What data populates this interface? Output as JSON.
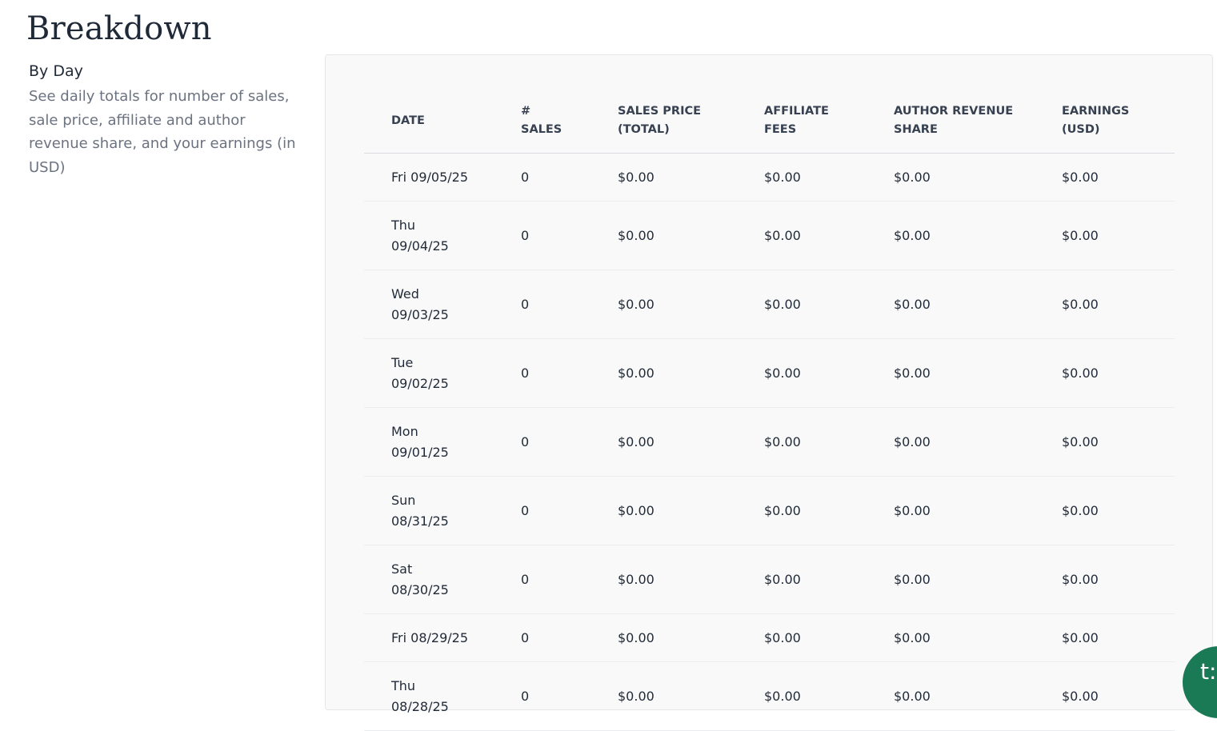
{
  "page": {
    "title": "Breakdown"
  },
  "section": {
    "title": "By Day",
    "description": "See daily totals for number of sales, sale price, affiliate and author revenue share, and your earnings (in USD)"
  },
  "table": {
    "headers": {
      "date": "DATE",
      "sales_line1": "#",
      "sales_line2": "SALES",
      "price_line1": "SALES PRICE",
      "price_line2": "(TOTAL)",
      "affiliate_line1": "AFFILIATE",
      "affiliate_line2": "FEES",
      "author_line1": "AUTHOR REVENUE",
      "author_line2": "SHARE",
      "earnings_line1": "EARNINGS",
      "earnings_line2": "(USD)"
    },
    "rows": [
      {
        "day": "Fri",
        "date": "09/05/25",
        "sales": "0",
        "price": "$0.00",
        "affiliate": "$0.00",
        "author": "$0.00",
        "earnings": "$0.00"
      },
      {
        "day": "Thu",
        "date": "09/04/25",
        "sales": "0",
        "price": "$0.00",
        "affiliate": "$0.00",
        "author": "$0.00",
        "earnings": "$0.00"
      },
      {
        "day": "Wed",
        "date": "09/03/25",
        "sales": "0",
        "price": "$0.00",
        "affiliate": "$0.00",
        "author": "$0.00",
        "earnings": "$0.00"
      },
      {
        "day": "Tue",
        "date": "09/02/25",
        "sales": "0",
        "price": "$0.00",
        "affiliate": "$0.00",
        "author": "$0.00",
        "earnings": "$0.00"
      },
      {
        "day": "Mon",
        "date": "09/01/25",
        "sales": "0",
        "price": "$0.00",
        "affiliate": "$0.00",
        "author": "$0.00",
        "earnings": "$0.00"
      },
      {
        "day": "Sun",
        "date": "08/31/25",
        "sales": "0",
        "price": "$0.00",
        "affiliate": "$0.00",
        "author": "$0.00",
        "earnings": "$0.00"
      },
      {
        "day": "Sat",
        "date": "08/30/25",
        "sales": "0",
        "price": "$0.00",
        "affiliate": "$0.00",
        "author": "$0.00",
        "earnings": "$0.00"
      },
      {
        "day": "Fri",
        "date": "08/29/25",
        "sales": "0",
        "price": "$0.00",
        "affiliate": "$0.00",
        "author": "$0.00",
        "earnings": "$0.00"
      },
      {
        "day": "Thu",
        "date": "08/28/25",
        "sales": "0",
        "price": "$0.00",
        "affiliate": "$0.00",
        "author": "$0.00",
        "earnings": "$0.00"
      }
    ]
  },
  "chat_widget": {
    "label": "t:",
    "icon": "chat-launcher-icon",
    "color": "#1a7a55"
  }
}
